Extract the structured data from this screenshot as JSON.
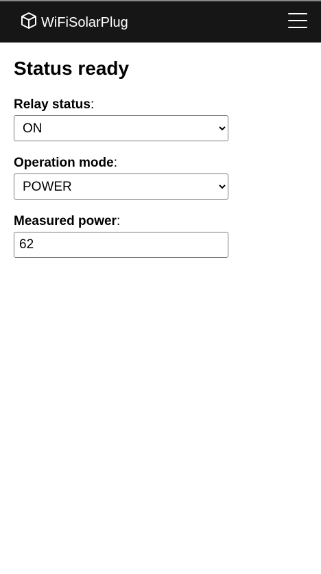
{
  "header": {
    "brand_name": "WiFiSolarPlug",
    "brand_icon": "cube-icon",
    "menu_icon": "hamburger-menu-icon",
    "background_color": "#161616"
  },
  "page": {
    "title": "Status ready"
  },
  "fields": {
    "relay": {
      "label": "Relay status",
      "suffix": ":",
      "value": "ON"
    },
    "mode": {
      "label": "Operation mode",
      "suffix": ":",
      "value": "POWER"
    },
    "power": {
      "label": "Measured power",
      "suffix": ":",
      "value": "62"
    }
  }
}
